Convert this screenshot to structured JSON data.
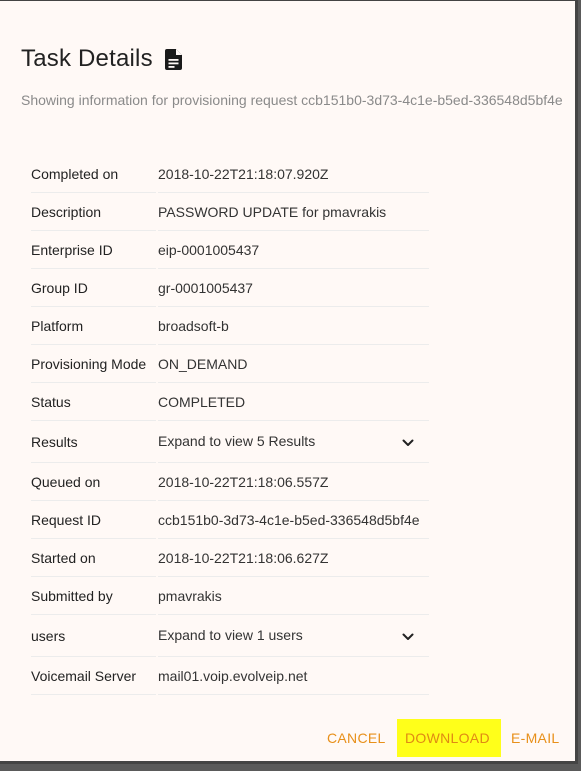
{
  "dialog": {
    "title": "Task Details",
    "subtitle": "Showing information for provisioning request ccb151b0-3d73-4c1e-b5ed-336548d5bf4e"
  },
  "details": [
    {
      "label": "Completed on",
      "value": "2018-10-22T21:18:07.920Z"
    },
    {
      "label": "Description",
      "value": "PASSWORD UPDATE for pmavrakis"
    },
    {
      "label": "Enterprise ID",
      "value": "eip-0001005437"
    },
    {
      "label": "Group ID",
      "value": "gr-0001005437"
    },
    {
      "label": "Platform",
      "value": "broadsoft-b"
    },
    {
      "label": "Provisioning Mode",
      "value": "ON_DEMAND"
    },
    {
      "label": "Status",
      "value": "COMPLETED"
    },
    {
      "label": "Results",
      "value": "Expand to view 5 Results"
    },
    {
      "label": "Queued on",
      "value": "2018-10-22T21:18:06.557Z"
    },
    {
      "label": "Request ID",
      "value": "ccb151b0-3d73-4c1e-b5ed-336548d5bf4e"
    },
    {
      "label": "Started on",
      "value": "2018-10-22T21:18:06.627Z"
    },
    {
      "label": "Submitted by",
      "value": "pmavrakis"
    },
    {
      "label": "users",
      "value": "Expand to view 1 users"
    },
    {
      "label": "Voicemail Server",
      "value": "mail01.voip.evolveip.net"
    }
  ],
  "actions": {
    "cancel": "CANCEL",
    "download": "DOWNLOAD",
    "email": "E-MAIL"
  },
  "colors": {
    "accent": "#e8901a",
    "highlight": "#ffff1a",
    "background": "#fff9f6"
  },
  "icons": {
    "title_icon": "document-icon",
    "expand_icon": "chevron-down-icon"
  }
}
